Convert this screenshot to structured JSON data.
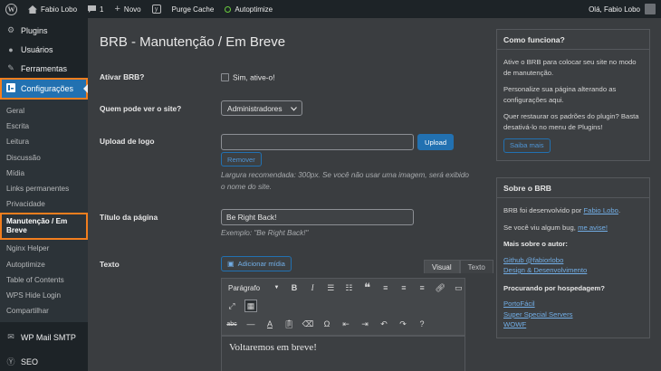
{
  "adminbar": {
    "site_name": "Fabio Lobo",
    "comments_count": "1",
    "new_label": "Novo",
    "purge_cache": "Purge Cache",
    "autoptimize": "Autoptimize",
    "greeting": "Olá, Fabio Lobo"
  },
  "sidebar": {
    "top_items": [
      {
        "label": "Plugins",
        "icon": "plugin-icon"
      },
      {
        "label": "Usuários",
        "icon": "users-icon"
      },
      {
        "label": "Ferramentas",
        "icon": "tools-icon"
      }
    ],
    "current": {
      "label": "Configurações",
      "icon": "settings-icon"
    },
    "submenu": [
      "Geral",
      "Escrita",
      "Leitura",
      "Discussão",
      "Mídia",
      "Links permanentes",
      "Privacidade"
    ],
    "submenu_current": "Manutenção / Em Breve",
    "submenu_after": [
      "Nginx Helper",
      "Autoptimize",
      "Table of Contents",
      "WPS Hide Login",
      "Compartilhar"
    ],
    "bottom_items": [
      {
        "label": "WP Mail SMTP",
        "icon": "mail-icon"
      },
      {
        "label": "SEO",
        "icon": "seo-icon"
      }
    ]
  },
  "main": {
    "title": "BRB - Manutenção / Em Breve",
    "ativar_label": "Ativar BRB?",
    "ativar_checkbox": "Sim, ative-o!",
    "quem_label": "Quem pode ver o site?",
    "quem_value": "Administradores",
    "upload_label": "Upload de logo",
    "upload_value": "",
    "upload_button": "Upload",
    "remover_button": "Remover",
    "upload_hint": "Largura recomendada: 300px. Se você não usar uma imagem, será exibido o nome do site.",
    "titulo_label": "Título da página",
    "titulo_value": "Be Right Back!",
    "titulo_hint": "Exemplo: \"Be Right Back!\"",
    "texto_label": "Texto",
    "add_media": "Adicionar mídia",
    "tab_visual": "Visual",
    "tab_texto": "Texto",
    "format_select": "Parágrafo",
    "editor_content": "Voltaremos em breve!"
  },
  "panels": {
    "como": {
      "title": "Como funciona?",
      "p1": "Ative o BRB para colocar seu site no modo de manutenção.",
      "p2": "Personalize sua página alterando as configurações aqui.",
      "p3": "Quer restaurar os padrões do plugin? Basta desativá-lo no menu de Plugins!",
      "button": "Saiba mais"
    },
    "sobre": {
      "title": "Sobre o BRB",
      "dev_text": "BRB foi desenvolvido por",
      "dev_link": "Fabio Lobo",
      "bug_text": "Se você viu algum bug,",
      "bug_link": "me avise!",
      "autor_heading": "Mais sobre o autor:",
      "autor_links": [
        "Github @fabiorlobo",
        "Design & Desenvolvimento"
      ],
      "hosting_heading": "Procurando por hospedagem?",
      "hosting_links": [
        "PortoFácil",
        "Super Special Servers",
        "WOWF"
      ]
    }
  },
  "colors": {
    "accent": "#2271b1",
    "highlight": "#f27e1e",
    "link": "#72aee6"
  }
}
